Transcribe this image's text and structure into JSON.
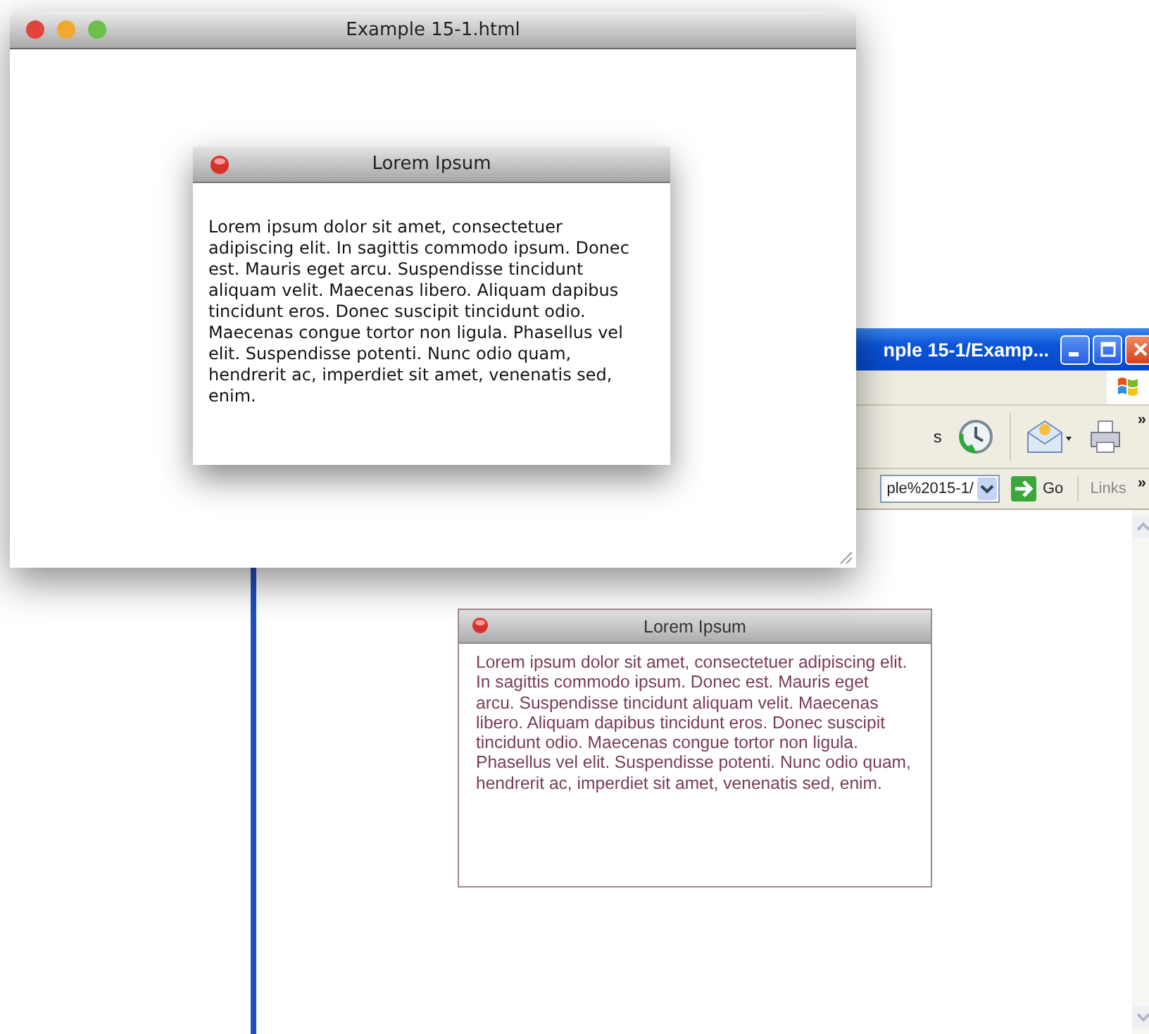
{
  "mac_window": {
    "title": "Example 15-1.html",
    "dialog": {
      "title": "Lorem Ipsum",
      "text": "Lorem ipsum dolor sit amet, consectetuer adipiscing elit. In sagittis commodo ipsum. Donec est. Mauris eget arcu. Suspendisse tincidunt aliquam velit. Maecenas libero. Aliquam dapibus tincidunt eros. Donec suscipit tincidunt odio. Maecenas congue tortor non ligula. Phasellus vel elit. Suspendisse potenti. Nunc odio quam, hendrerit ac, imperdiet sit amet, venenatis sed, enim."
    }
  },
  "ie_window": {
    "title": "nple 15-1/Examp...",
    "toolbar": {
      "partial_label": "s",
      "chevron": "»"
    },
    "address": {
      "value": "ple%2015-1/",
      "go_label": "Go",
      "links_label": "Links",
      "links_chevron": "»"
    },
    "dialog": {
      "title": "Lorem Ipsum",
      "text": "Lorem ipsum dolor sit amet, consectetuer adipiscing elit. In sagittis commodo ipsum. Donec est. Mauris eget arcu. Suspendisse tincidunt aliquam velit. Maecenas libero. Aliquam dapibus tincidunt eros. Donec suscipit tincidunt odio. Maecenas congue tortor non ligula. Phasellus vel elit. Suspendisse potenti. Nunc odio quam, hendrerit ac, imperdiet sit amet, venenatis sed, enim."
    }
  }
}
